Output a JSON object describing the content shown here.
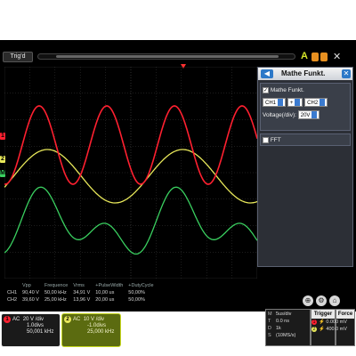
{
  "topbar": {
    "trigger_state": "Trig'd",
    "run_label": "A"
  },
  "colors": {
    "ch1": "#ff2030",
    "ch2": "#e8e85a",
    "math": "#3ad060",
    "grid": "#3a3a3a",
    "accent": "#2c78c8"
  },
  "markers": {
    "ch1": "1",
    "ch2": "2",
    "math": "M"
  },
  "math_panel": {
    "title": "Mathe Funkt.",
    "enable_label": "Mathe Funkt.",
    "enable_checked": true,
    "source1": "CH1",
    "operator": "+",
    "source2": "CH2",
    "voltage_label": "Voltage(/div):",
    "voltage_value": "20V",
    "fft_label": "FFT",
    "fft_checked": false,
    "back_icon": "arrow-left-icon",
    "close_icon": "close-icon"
  },
  "measurements": {
    "headers": [
      "",
      "Vpp",
      "Frequence",
      "Vrms",
      "+PulseWidth",
      "+DutyCycle"
    ],
    "rows": [
      [
        "CH1",
        "90,40 V",
        "50,00 kHz",
        "34,91 V",
        "10,00 us",
        "50,00%"
      ],
      [
        "CH2",
        "39,60 V",
        "25,00 kHz",
        "13,96 V",
        "20,00 us",
        "50,00%"
      ]
    ]
  },
  "channels": [
    {
      "badge": "1",
      "coupling": "AC",
      "vdiv": "20 V /div",
      "pos": "1.0divs",
      "freq": "50,001 kHz"
    },
    {
      "badge": "2",
      "coupling": "AC",
      "vdiv": "10 V /div",
      "pos": "-1.0divs",
      "freq": "25,000 kHz"
    }
  ],
  "timebase": {
    "rows": [
      {
        "k": "M",
        "v": "5us/div"
      },
      {
        "k": "T",
        "v": "0.0 ns"
      },
      {
        "k": "D",
        "v": "1k"
      },
      {
        "k": "S",
        "v": "(10MS/s)"
      }
    ]
  },
  "trigger": {
    "trigger_label": "Trigger",
    "force_label": "Force",
    "ch1_level": "0.000 mV",
    "ch2_level": "400.0 mV"
  },
  "tools": [
    "zoom-icon",
    "settings-icon",
    "home-icon"
  ]
}
